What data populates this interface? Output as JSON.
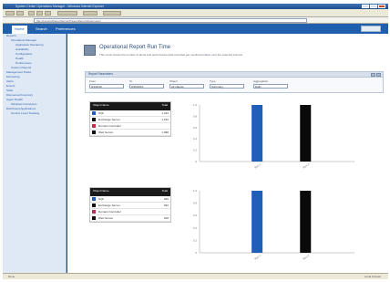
{
  "window": {
    "title": "System Center Operations Manager - Windows Internet Explorer"
  },
  "toolbar": {
    "buttons": [
      "back-icon",
      "forward-icon",
      "stop-icon",
      "refresh-icon",
      "home-icon",
      "favorites-icon",
      "print-icon",
      "tools-icon"
    ]
  },
  "address": {
    "url": "http://reports/ReportServer/Pages/ReportViewer.aspx"
  },
  "nav": {
    "tabs": [
      "Home",
      "Search",
      "Preferences"
    ],
    "active": 0
  },
  "sidebar": {
    "items": [
      {
        "label": "Reports",
        "level": 0
      },
      {
        "label": "Operations Manager",
        "level": 1
      },
      {
        "label": "Application Monitoring",
        "level": 2
      },
      {
        "label": "Availability",
        "level": 2
      },
      {
        "label": "Configuration",
        "level": 2
      },
      {
        "label": "Health",
        "level": 2
      },
      {
        "label": "Performance",
        "level": 2
      },
      {
        "label": "Custom Reports",
        "level": 1
      },
      {
        "label": "Management Packs",
        "level": 0
      },
      {
        "label": "Monitoring",
        "level": 0
      },
      {
        "label": "Alerts",
        "level": 0
      },
      {
        "label": "Events",
        "level": 0
      },
      {
        "label": "State",
        "level": 0
      },
      {
        "label": "Discovered Inventory",
        "level": 0
      },
      {
        "label": "Agent Health",
        "level": 0
      },
      {
        "label": "Windows Computers",
        "level": 1
      },
      {
        "label": "Distributed Applications",
        "level": 0
      },
      {
        "label": "Service Level Tracking",
        "level": 1
      }
    ]
  },
  "page": {
    "title": "Operational Report Run Time",
    "description": "This report shows the number of alerts and performance data recorded per monitored object over the selected interval."
  },
  "filter": {
    "header": "Report Parameters",
    "fields": [
      {
        "label": "From",
        "value": "9/1/2010"
      },
      {
        "label": "To",
        "value": "9/30/2010"
      },
      {
        "label": "Object",
        "value": "All objects"
      },
      {
        "label": "Type",
        "value": "Summary"
      },
      {
        "label": "Aggregation",
        "value": "Daily"
      }
    ]
  },
  "legends": [
    {
      "header": [
        "Object Name",
        "Total"
      ],
      "rows": [
        {
          "label": "SQL",
          "value": "1,234",
          "color": "#1f5fb8"
        },
        {
          "label": "Exchange Server",
          "value": "1,152",
          "color": "#111111"
        },
        {
          "label": "Domain Controller",
          "value": "",
          "color": "#c0304a"
        },
        {
          "label": "Web Server",
          "value": "1,098",
          "color": "#111111"
        }
      ]
    },
    {
      "header": [
        "Object Name",
        "Total"
      ],
      "rows": [
        {
          "label": "SQL",
          "value": "946",
          "color": "#1f5fb8"
        },
        {
          "label": "Exchange Server",
          "value": "932",
          "color": "#111111"
        },
        {
          "label": "Domain Controller",
          "value": "",
          "color": "#c0304a"
        },
        {
          "label": "Web Server",
          "value": "918",
          "color": "#111111"
        }
      ]
    }
  ],
  "chart_data": [
    {
      "type": "bar",
      "categories": [
        "Run 1",
        "Run 2"
      ],
      "series": [
        {
          "values": [
            1.0,
            1.0
          ]
        }
      ],
      "colors": [
        "#1f5fb8",
        "#0a0a0a"
      ],
      "ylim": [
        0,
        1.0
      ],
      "yticks": [
        "1.0",
        "0.8",
        "0.6",
        "0.4",
        "0.2",
        "0"
      ],
      "grid": false
    },
    {
      "type": "bar",
      "categories": [
        "Run 1",
        "Run 2"
      ],
      "series": [
        {
          "values": [
            1.0,
            1.0
          ]
        }
      ],
      "colors": [
        "#1f5fb8",
        "#0a0a0a"
      ],
      "ylim": [
        0,
        1.0
      ],
      "yticks": [
        "1.0",
        "0.8",
        "0.6",
        "0.4",
        "0.2",
        "0"
      ],
      "grid": false
    }
  ],
  "status": {
    "text": "Done",
    "zone": "Local intranet"
  }
}
